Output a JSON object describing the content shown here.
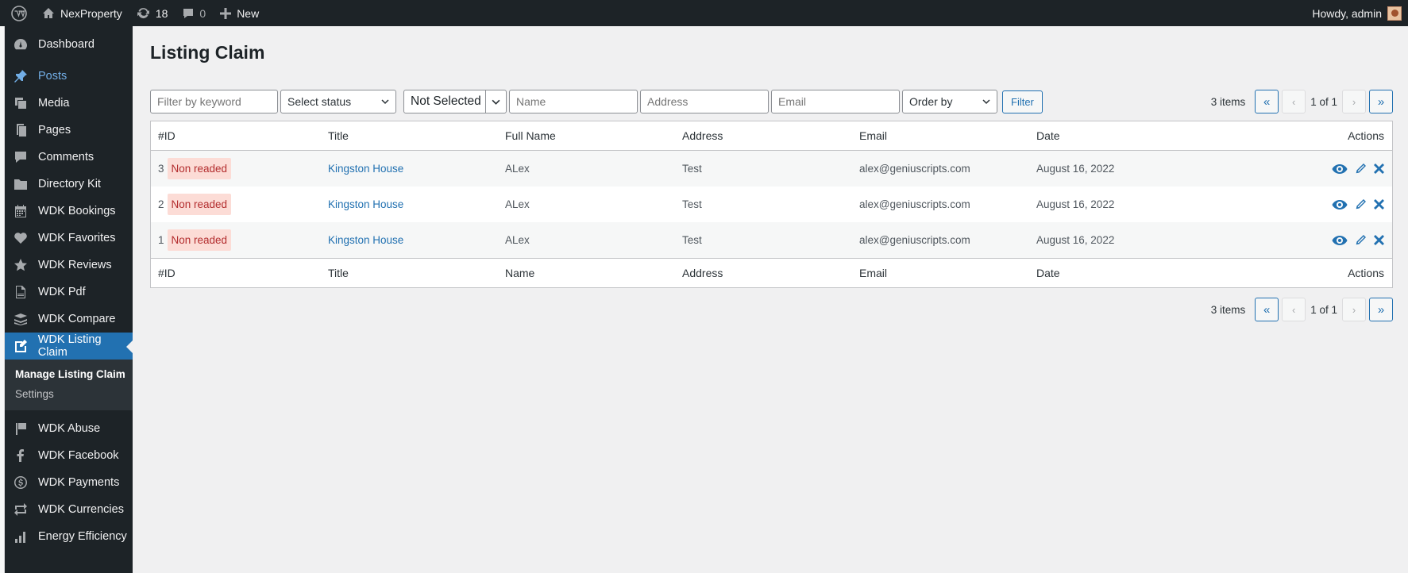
{
  "adminbar": {
    "site_name": "NexProperty",
    "updates_count": "18",
    "comments_count": "0",
    "new_label": "New",
    "greeting": "Howdy, admin"
  },
  "sidebar": {
    "items": [
      {
        "label": "Dashboard",
        "icon": "dashboard-icon"
      },
      {
        "label": "Posts",
        "icon": "pin-icon"
      },
      {
        "label": "Media",
        "icon": "media-icon"
      },
      {
        "label": "Pages",
        "icon": "pages-icon"
      },
      {
        "label": "Comments",
        "icon": "comments-icon"
      },
      {
        "label": "Directory Kit",
        "icon": "folder-icon"
      },
      {
        "label": "WDK Bookings",
        "icon": "calendar-icon"
      },
      {
        "label": "WDK Favorites",
        "icon": "heart-icon"
      },
      {
        "label": "WDK Reviews",
        "icon": "star-icon"
      },
      {
        "label": "WDK Pdf",
        "icon": "pdf-icon"
      },
      {
        "label": "WDK Compare",
        "icon": "compare-icon"
      },
      {
        "label": "WDK Listing Claim",
        "icon": "edit-page-icon"
      },
      {
        "label": "WDK Abuse",
        "icon": "flag-icon"
      },
      {
        "label": "WDK Facebook",
        "icon": "facebook-icon"
      },
      {
        "label": "WDK Payments",
        "icon": "dollar-icon"
      },
      {
        "label": "WDK Currencies",
        "icon": "currency-icon"
      },
      {
        "label": "Energy Efficiency",
        "icon": "chart-icon"
      }
    ],
    "submenu": {
      "manage": "Manage Listing Claim",
      "settings": "Settings"
    }
  },
  "page": {
    "title": "Listing Claim"
  },
  "filters": {
    "keyword_placeholder": "Filter by keyword",
    "status_value": "Select status",
    "not_selected": "Not Selected",
    "name_placeholder": "Name",
    "address_placeholder": "Address",
    "email_placeholder": "Email",
    "order_value": "Order by",
    "filter_button": "Filter"
  },
  "pagination": {
    "items": "3 items",
    "first": "«",
    "prev": "‹",
    "info": "1 of 1",
    "next": "›",
    "last": "»"
  },
  "table": {
    "header": {
      "id": "#ID",
      "title": "Title",
      "name": "Full Name",
      "address": "Address",
      "email": "Email",
      "date": "Date",
      "actions": "Actions"
    },
    "footer": {
      "id": "#ID",
      "title": "Title",
      "name": "Name",
      "address": "Address",
      "email": "Email",
      "date": "Date",
      "actions": "Actions"
    },
    "rows": [
      {
        "id": "3",
        "status": "Non readed",
        "title": "Kingston House",
        "name": "ALex",
        "address": "Test",
        "email": "alex@geniuscripts.com",
        "date": "August 16, 2022"
      },
      {
        "id": "2",
        "status": "Non readed",
        "title": "Kingston House",
        "name": "ALex",
        "address": "Test",
        "email": "alex@geniuscripts.com",
        "date": "August 16, 2022"
      },
      {
        "id": "1",
        "status": "Non readed",
        "title": "Kingston House",
        "name": "ALex",
        "address": "Test",
        "email": "alex@geniuscripts.com",
        "date": "August 16, 2022"
      }
    ]
  }
}
